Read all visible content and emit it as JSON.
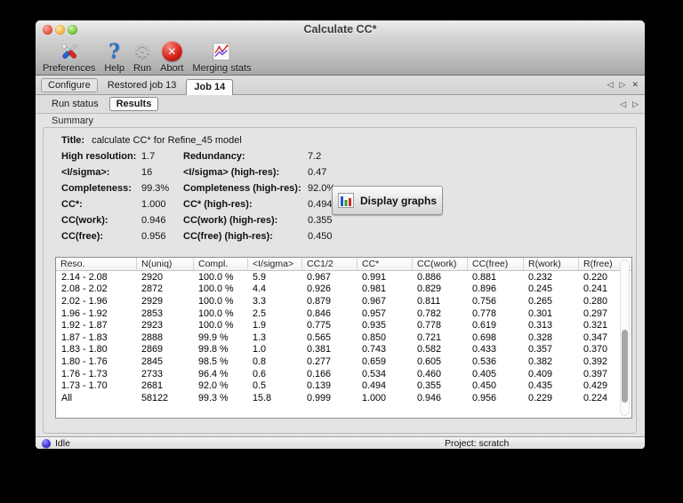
{
  "window": {
    "title": "Calculate CC*"
  },
  "toolbar": {
    "items": [
      {
        "label": "Preferences",
        "icon": "tools-icon"
      },
      {
        "label": "Help",
        "icon": "question-icon",
        "glyph": "?"
      },
      {
        "label": "Run",
        "icon": "gear-icon",
        "glyph": "⚙"
      },
      {
        "label": "Abort",
        "icon": "stop-icon",
        "glyph": "✕"
      },
      {
        "label": "Merging stats",
        "icon": "chart-icon"
      }
    ]
  },
  "job_tabs": {
    "tabs": [
      {
        "label": "Configure"
      },
      {
        "label": "Restored job 13"
      },
      {
        "label": "Job 14"
      }
    ],
    "active": "Job 14",
    "nav": {
      "prev": "◁",
      "next": "▷",
      "close": "✕"
    }
  },
  "result_tabs": {
    "tabs": [
      {
        "label": "Run status"
      },
      {
        "label": "Results"
      }
    ],
    "active": "Results",
    "nav": {
      "prev": "◁",
      "next": "▷"
    }
  },
  "summary": {
    "section_label": "Summary",
    "title_label": "Title:",
    "title_value": "calculate CC* for Refine_45 model",
    "stats": [
      {
        "label1": "High resolution:",
        "value1": "1.7",
        "label2": "Redundancy:",
        "value2": "7.2"
      },
      {
        "label1": "<I/sigma>:",
        "value1": "16",
        "label2": "<I/sigma> (high-res):",
        "value2": "0.47"
      },
      {
        "label1": "Completeness:",
        "value1": "99.3%",
        "label2": "Completeness (high-res):",
        "value2": "92.0%"
      },
      {
        "label1": "CC*:",
        "value1": "1.000",
        "label2": "CC* (high-res):",
        "value2": "0.494"
      },
      {
        "label1": "CC(work):",
        "value1": "0.946",
        "label2": "CC(work) (high-res):",
        "value2": "0.355"
      },
      {
        "label1": "CC(free):",
        "value1": "0.956",
        "label2": "CC(free) (high-res):",
        "value2": "0.450"
      }
    ],
    "display_graphs_label": "Display graphs"
  },
  "table": {
    "columns": [
      "Reso.",
      "N(uniq)",
      "Compl.",
      "<I/sigma>",
      "CC1/2",
      "CC*",
      "CC(work)",
      "CC(free)",
      "R(work)",
      "R(free)"
    ],
    "rows": [
      [
        "2.14 - 2.08",
        "2920",
        "100.0 %",
        "5.9",
        "0.967",
        "0.991",
        "0.886",
        "0.881",
        "0.232",
        "0.220"
      ],
      [
        "2.08 - 2.02",
        "2872",
        "100.0 %",
        "4.4",
        "0.926",
        "0.981",
        "0.829",
        "0.896",
        "0.245",
        "0.241"
      ],
      [
        "2.02 - 1.96",
        "2929",
        "100.0 %",
        "3.3",
        "0.879",
        "0.967",
        "0.811",
        "0.756",
        "0.265",
        "0.280"
      ],
      [
        "1.96 - 1.92",
        "2853",
        "100.0 %",
        "2.5",
        "0.846",
        "0.957",
        "0.782",
        "0.778",
        "0.301",
        "0.297"
      ],
      [
        "1.92 - 1.87",
        "2923",
        "100.0 %",
        "1.9",
        "0.775",
        "0.935",
        "0.778",
        "0.619",
        "0.313",
        "0.321"
      ],
      [
        "1.87 - 1.83",
        "2888",
        "99.9 %",
        "1.3",
        "0.565",
        "0.850",
        "0.721",
        "0.698",
        "0.328",
        "0.347"
      ],
      [
        "1.83 - 1.80",
        "2869",
        "99.8 %",
        "1.0",
        "0.381",
        "0.743",
        "0.582",
        "0.433",
        "0.357",
        "0.370"
      ],
      [
        "1.80 - 1.76",
        "2845",
        "98.5 %",
        "0.8",
        "0.277",
        "0.659",
        "0.605",
        "0.536",
        "0.382",
        "0.392"
      ],
      [
        "1.76 - 1.73",
        "2733",
        "96.4 %",
        "0.6",
        "0.166",
        "0.534",
        "0.460",
        "0.405",
        "0.409",
        "0.397"
      ],
      [
        "1.73 - 1.70",
        "2681",
        "92.0 %",
        "0.5",
        "0.139",
        "0.494",
        "0.355",
        "0.450",
        "0.435",
        "0.429"
      ],
      [
        "All",
        "58122",
        "99.3 %",
        "15.8",
        "0.999",
        "1.000",
        "0.946",
        "0.956",
        "0.229",
        "0.224"
      ]
    ]
  },
  "statusbar": {
    "status": "Idle",
    "project": "Project: scratch"
  },
  "colors": {
    "help_blue": "#2e6fd2",
    "abort_red": "#d8261b",
    "status_sphere_blue": "#4338e0",
    "chart_bar_blue": "#2457c5",
    "chart_bar_green": "#2e9e3a",
    "chart_bar_red": "#cf2a21"
  }
}
